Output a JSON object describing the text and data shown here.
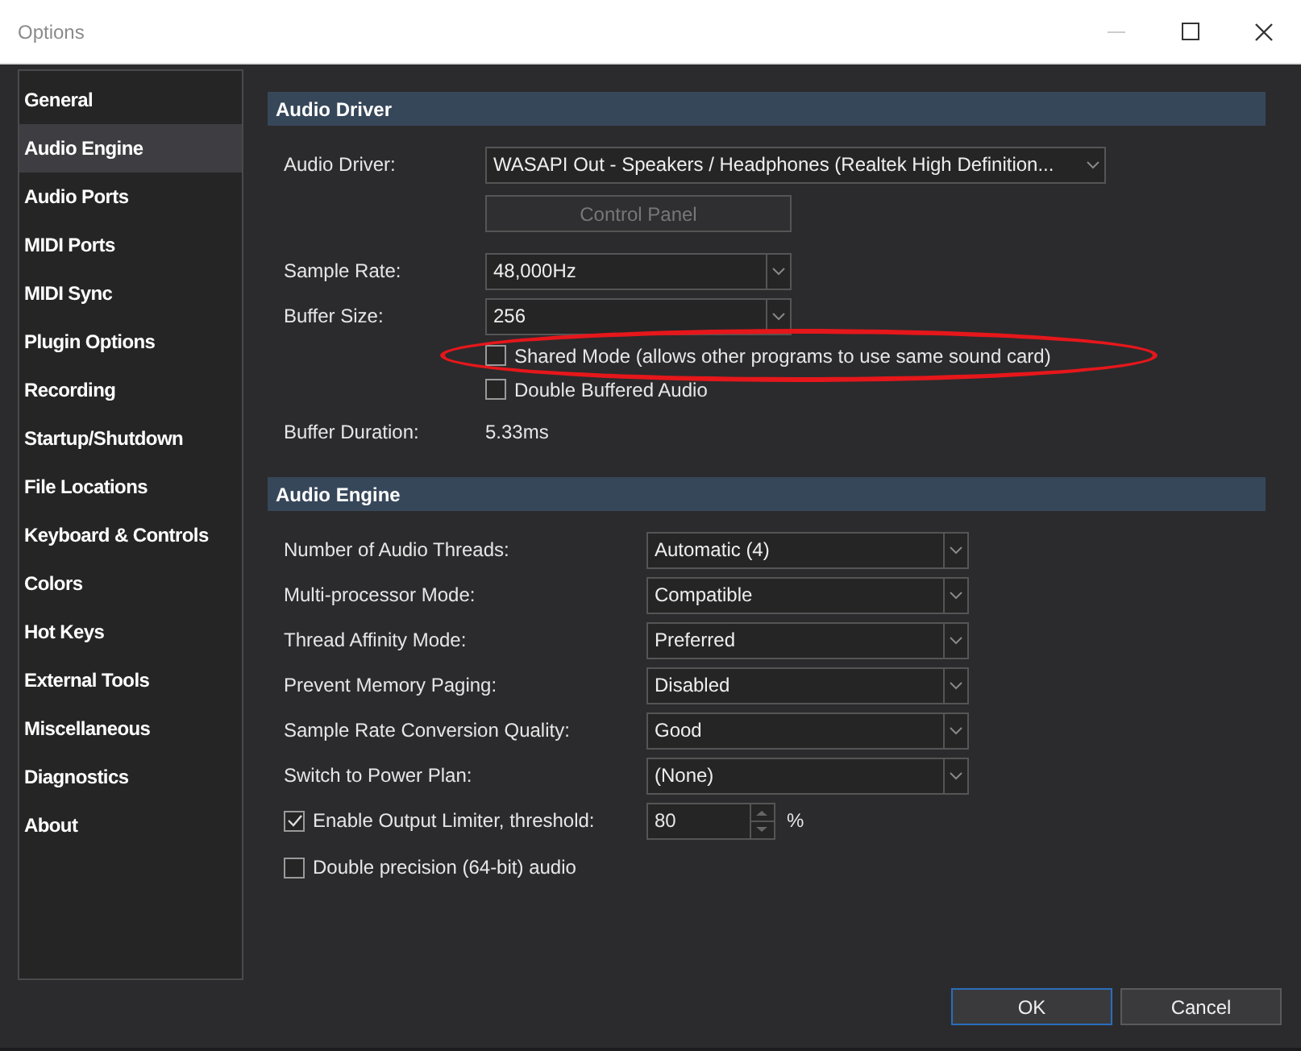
{
  "window": {
    "title": "Options"
  },
  "sidebar": {
    "items": [
      {
        "label": "General",
        "selected": false
      },
      {
        "label": "Audio Engine",
        "selected": true
      },
      {
        "label": "Audio Ports",
        "selected": false
      },
      {
        "label": "MIDI Ports",
        "selected": false
      },
      {
        "label": "MIDI Sync",
        "selected": false
      },
      {
        "label": "Plugin Options",
        "selected": false
      },
      {
        "label": "Recording",
        "selected": false
      },
      {
        "label": "Startup/Shutdown",
        "selected": false
      },
      {
        "label": "File Locations",
        "selected": false
      },
      {
        "label": "Keyboard & Controls",
        "selected": false
      },
      {
        "label": "Colors",
        "selected": false
      },
      {
        "label": "Hot Keys",
        "selected": false
      },
      {
        "label": "External Tools",
        "selected": false
      },
      {
        "label": "Miscellaneous",
        "selected": false
      },
      {
        "label": "Diagnostics",
        "selected": false
      },
      {
        "label": "About",
        "selected": false
      }
    ]
  },
  "sections": [
    {
      "title": "Audio Driver",
      "rows": [
        {
          "kind": "select",
          "label": "Audio Driver:",
          "value": "WASAPI Out - Speakers / Headphones (Realtek High Definition..."
        },
        {
          "kind": "button",
          "label": "Control Panel",
          "disabled": true
        },
        {
          "kind": "select",
          "label": "Sample Rate:",
          "value": "48,000Hz"
        },
        {
          "kind": "select",
          "label": "Buffer Size:",
          "value": "256"
        },
        {
          "kind": "checkbox",
          "label": "Shared Mode (allows other programs to use same sound card)",
          "checked": false,
          "highlighted": true
        },
        {
          "kind": "checkbox",
          "label": "Double Buffered Audio",
          "checked": false,
          "highlighted": false
        },
        {
          "kind": "text",
          "label": "Buffer Duration:",
          "value": "5.33ms"
        }
      ]
    },
    {
      "title": "Audio Engine",
      "rows": [
        {
          "kind": "select",
          "label": "Number of Audio Threads:",
          "value": "Automatic (4)"
        },
        {
          "kind": "select",
          "label": "Multi-processor Mode:",
          "value": "Compatible"
        },
        {
          "kind": "select",
          "label": "Thread Affinity Mode:",
          "value": "Preferred"
        },
        {
          "kind": "select",
          "label": "Prevent Memory Paging:",
          "value": "Disabled"
        },
        {
          "kind": "select",
          "label": "Sample Rate Conversion Quality:",
          "value": "Good"
        },
        {
          "kind": "select",
          "label": "Switch to Power Plan:",
          "value": "(None)"
        },
        {
          "kind": "spin",
          "label": "Enable Output Limiter, threshold:",
          "checked": true,
          "value": "80",
          "unit": "%"
        },
        {
          "kind": "checkbox",
          "label": "Double precision (64-bit) audio",
          "checked": false,
          "highlighted": false
        }
      ]
    }
  ],
  "buttons": [
    {
      "label": "OK",
      "default": true
    },
    {
      "label": "Cancel",
      "default": false
    }
  ]
}
